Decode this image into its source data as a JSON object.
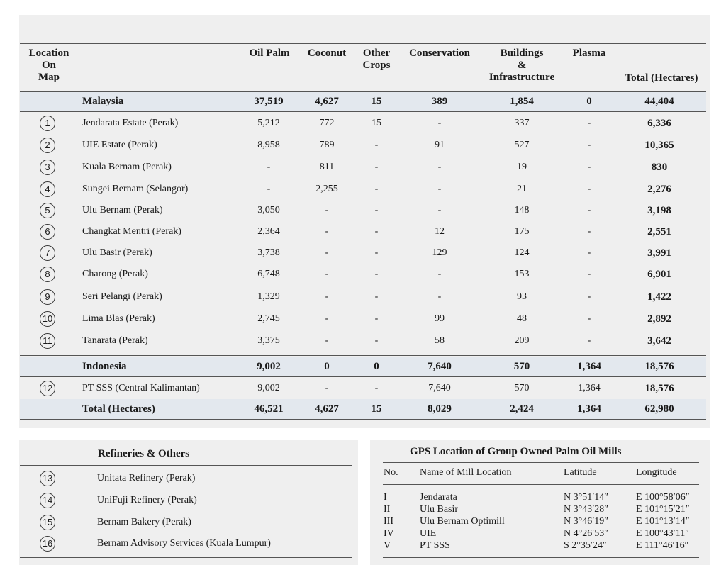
{
  "headers": {
    "location": [
      "Location",
      "On",
      "Map"
    ],
    "oil_palm": "Oil Palm",
    "coconut": "Coconut",
    "other_crops": [
      "Other",
      "Crops"
    ],
    "conservation": "Conservation",
    "buildings": [
      "Buildings",
      "&",
      "Infrastructure"
    ],
    "plasma": "Plasma",
    "total": "Total (Hectares)"
  },
  "rows": [
    {
      "kind": "group",
      "name": "Malaysia",
      "values": [
        "37,519",
        "4,627",
        "15",
        "389",
        "1,854",
        "0",
        "44,404"
      ]
    },
    {
      "kind": "item",
      "num": "1",
      "name": "Jendarata Estate (Perak)",
      "values": [
        "5,212",
        "772",
        "15",
        "-",
        "337",
        "-",
        "6,336"
      ]
    },
    {
      "kind": "item",
      "num": "2",
      "name": "UIE Estate (Perak)",
      "values": [
        "8,958",
        "789",
        "-",
        "91",
        "527",
        "-",
        "10,365"
      ]
    },
    {
      "kind": "item",
      "num": "3",
      "name": "Kuala Bernam (Perak)",
      "values": [
        "-",
        "811",
        "-",
        "-",
        "19",
        "-",
        "830"
      ]
    },
    {
      "kind": "item",
      "num": "4",
      "name": "Sungei Bernam (Selangor)",
      "values": [
        "-",
        "2,255",
        "-",
        "-",
        "21",
        "-",
        "2,276"
      ]
    },
    {
      "kind": "item",
      "num": "5",
      "name": "Ulu Bernam (Perak)",
      "values": [
        "3,050",
        "-",
        "-",
        "-",
        "148",
        "-",
        "3,198"
      ]
    },
    {
      "kind": "item",
      "num": "6",
      "name": "Changkat Mentri (Perak)",
      "values": [
        "2,364",
        "-",
        "-",
        "12",
        "175",
        "-",
        "2,551"
      ]
    },
    {
      "kind": "item",
      "num": "7",
      "name": "Ulu Basir (Perak)",
      "values": [
        "3,738",
        "-",
        "-",
        "129",
        "124",
        "-",
        "3,991"
      ]
    },
    {
      "kind": "item",
      "num": "8",
      "name": "Charong (Perak)",
      "values": [
        "6,748",
        "-",
        "-",
        "-",
        "153",
        "-",
        "6,901"
      ]
    },
    {
      "kind": "item",
      "num": "9",
      "name": "Seri Pelangi (Perak)",
      "values": [
        "1,329",
        "-",
        "-",
        "-",
        "93",
        "-",
        "1,422"
      ]
    },
    {
      "kind": "item",
      "num": "10",
      "name": "Lima Blas (Perak)",
      "values": [
        "2,745",
        "-",
        "-",
        "99",
        "48",
        "-",
        "2,892"
      ]
    },
    {
      "kind": "item",
      "num": "11",
      "name": "Tanarata (Perak)",
      "values": [
        "3,375",
        "-",
        "-",
        "58",
        "209",
        "-",
        "3,642"
      ]
    },
    {
      "kind": "group",
      "name": "Indonesia",
      "values": [
        "9,002",
        "0",
        "0",
        "7,640",
        "570",
        "1,364",
        "18,576"
      ]
    },
    {
      "kind": "item",
      "num": "12",
      "name": "PT SSS (Central Kalimantan)",
      "values": [
        "9,002",
        "-",
        "-",
        "7,640",
        "570",
        "1,364",
        "18,576"
      ]
    },
    {
      "kind": "group",
      "name": "Total (Hectares)",
      "values": [
        "46,521",
        "4,627",
        "15",
        "8,029",
        "2,424",
        "1,364",
        "62,980"
      ]
    }
  ],
  "refineries": {
    "title": "Refineries & Others",
    "items": [
      {
        "num": "13",
        "name": "Unitata Refinery (Perak)"
      },
      {
        "num": "14",
        "name": "UniFuji Refinery (Perak)"
      },
      {
        "num": "15",
        "name": "Bernam Bakery (Perak)"
      },
      {
        "num": "16",
        "name": "Bernam Advisory Services (Kuala Lumpur)"
      }
    ]
  },
  "gps": {
    "title": "GPS Location of Group Owned Palm Oil Mills",
    "columns": [
      "No.",
      "Name of Mill Location",
      "Latitude",
      "Longitude"
    ],
    "rows": [
      [
        "I",
        "Jendarata",
        "N 3°51′14″",
        "E 100°58′06″"
      ],
      [
        "II",
        "Ulu Basir",
        "N 3°43′28″",
        "E 101°15′21″"
      ],
      [
        "III",
        "Ulu Bernam Optimill",
        "N 3°46′19″",
        "E 101°13′14″"
      ],
      [
        "IV",
        "UIE",
        "N 4°26′53″",
        "E 100°43′11″"
      ],
      [
        "V",
        "PT SSS",
        "S 2°35′24″",
        "E 111°46′16″"
      ]
    ]
  }
}
